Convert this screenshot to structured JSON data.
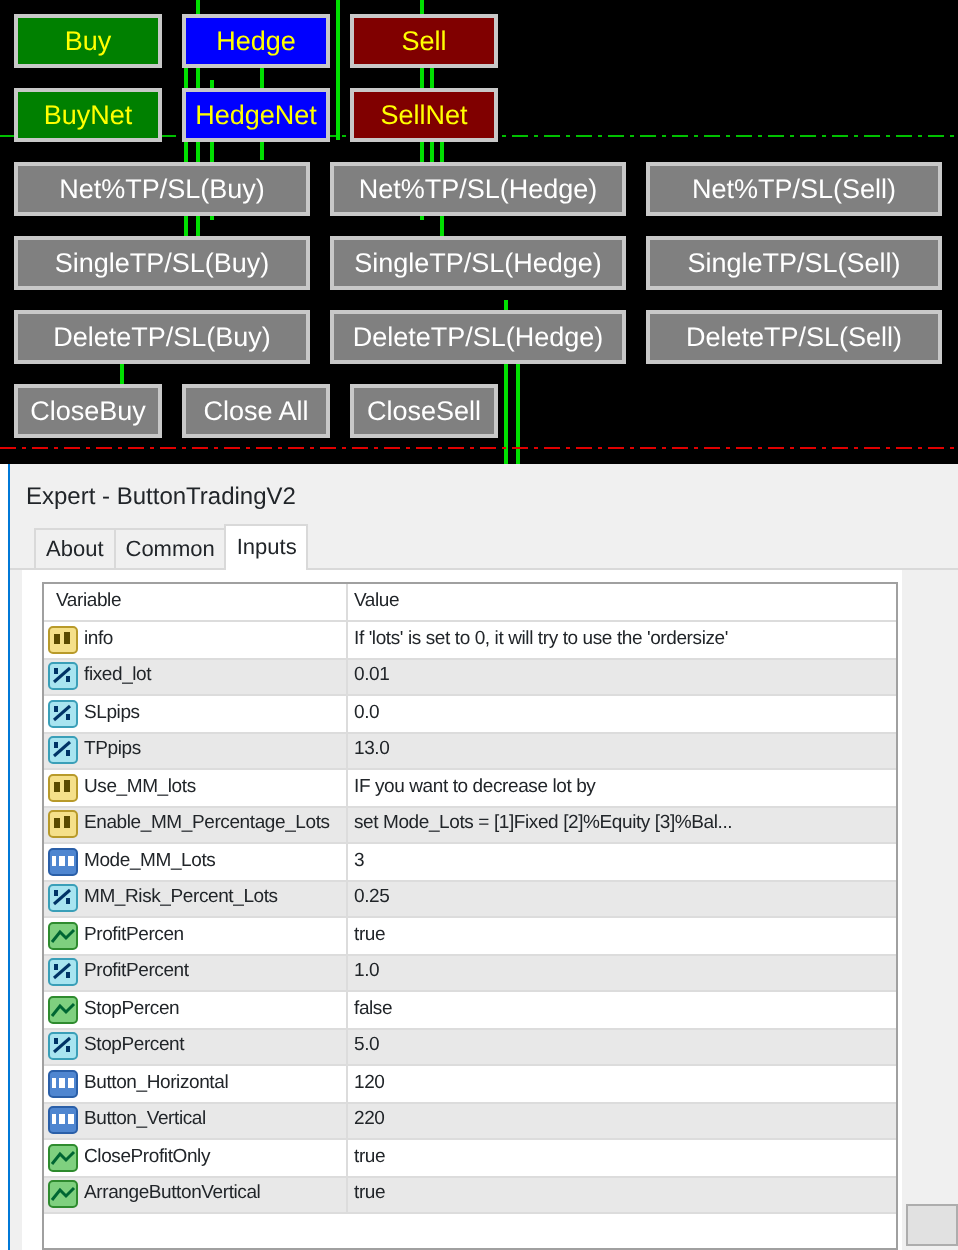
{
  "chart_buttons": [
    [
      {
        "label": "Buy",
        "kind": "buy"
      },
      {
        "label": "Hedge",
        "kind": "hedge"
      },
      {
        "label": "Sell",
        "kind": "sell"
      }
    ],
    [
      {
        "label": "BuyNet",
        "kind": "buy"
      },
      {
        "label": "HedgeNet",
        "kind": "hedge"
      },
      {
        "label": "SellNet",
        "kind": "sell"
      }
    ],
    [
      {
        "label": "Net%TP/SL(Buy)",
        "kind": "wide"
      },
      {
        "label": "Net%TP/SL(Hedge)",
        "kind": "wide"
      },
      {
        "label": "Net%TP/SL(Sell)",
        "kind": "wide"
      }
    ],
    [
      {
        "label": "SingleTP/SL(Buy)",
        "kind": "wide"
      },
      {
        "label": "SingleTP/SL(Hedge)",
        "kind": "wide"
      },
      {
        "label": "SingleTP/SL(Sell)",
        "kind": "wide"
      }
    ],
    [
      {
        "label": "DeleteTP/SL(Buy)",
        "kind": "wide"
      },
      {
        "label": "DeleteTP/SL(Hedge)",
        "kind": "wide"
      },
      {
        "label": "DeleteTP/SL(Sell)",
        "kind": "wide"
      }
    ],
    [
      {
        "label": "CloseBuy",
        "kind": "plain"
      },
      {
        "label": "Close All",
        "kind": "plain"
      },
      {
        "label": "CloseSell",
        "kind": "plain"
      }
    ]
  ],
  "window": {
    "title": "Expert - ButtonTradingV2"
  },
  "tabs": [
    {
      "label": "About",
      "selected": false
    },
    {
      "label": "Common",
      "selected": false
    },
    {
      "label": "Inputs",
      "selected": true
    }
  ],
  "table": {
    "columns": [
      "Variable",
      "Value"
    ],
    "rows": [
      {
        "kind": "string",
        "variable": "info",
        "value": "If 'lots' is set to 0, it will try to use the 'ordersize'"
      },
      {
        "kind": "double",
        "variable": "fixed_lot",
        "value": "0.01"
      },
      {
        "kind": "double",
        "variable": "SLpips",
        "value": "0.0"
      },
      {
        "kind": "double",
        "variable": "TPpips",
        "value": "13.0"
      },
      {
        "kind": "string",
        "variable": "Use_MM_lots",
        "value": "IF you want to decrease lot by"
      },
      {
        "kind": "string",
        "variable": "Enable_MM_Percentage_Lots",
        "value": "set Mode_Lots = [1]Fixed [2]%Equity [3]%Bal..."
      },
      {
        "kind": "int",
        "variable": "Mode_MM_Lots",
        "value": "3"
      },
      {
        "kind": "double",
        "variable": "MM_Risk_Percent_Lots",
        "value": "0.25"
      },
      {
        "kind": "bool",
        "variable": "ProfitPercen",
        "value": "true"
      },
      {
        "kind": "double",
        "variable": "ProfitPercent",
        "value": "1.0"
      },
      {
        "kind": "bool",
        "variable": "StopPercen",
        "value": "false"
      },
      {
        "kind": "double",
        "variable": "StopPercent",
        "value": "5.0"
      },
      {
        "kind": "int",
        "variable": "Button_Horizontal",
        "value": "120"
      },
      {
        "kind": "int",
        "variable": "Button_Vertical",
        "value": "220"
      },
      {
        "kind": "bool",
        "variable": "CloseProfitOnly",
        "value": "true"
      },
      {
        "kind": "bool",
        "variable": "ArrangeButtonVertical",
        "value": "true"
      }
    ]
  }
}
